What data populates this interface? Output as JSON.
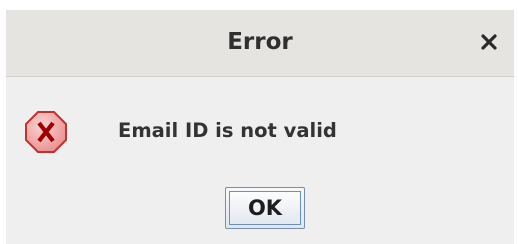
{
  "dialog": {
    "title": "Error",
    "close_icon": "close-icon",
    "message": "Email ID is not valid",
    "message_icon": "error-icon",
    "ok_label": "OK"
  },
  "colors": {
    "titlebar": "#e6e4e1",
    "body": "#efefef",
    "error_icon_fill": "#f0a3a3",
    "error_icon_stroke": "#c03232",
    "error_icon_glyph": "#a00000",
    "button_border": "#6c8fbd"
  }
}
